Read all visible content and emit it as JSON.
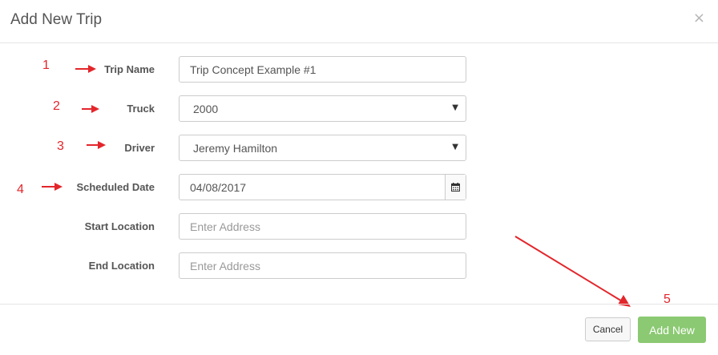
{
  "modal": {
    "title": "Add New Trip",
    "close_symbol": "×"
  },
  "form": {
    "trip_name": {
      "label": "Trip Name",
      "value": "Trip Concept Example #1"
    },
    "truck": {
      "label": "Truck",
      "value": "2000"
    },
    "driver": {
      "label": "Driver",
      "value": "Jeremy Hamilton"
    },
    "scheduled_date": {
      "label": "Scheduled Date",
      "value": "04/08/2017",
      "icon": "calendar-icon"
    },
    "start_location": {
      "label": "Start Location",
      "placeholder": "Enter Address"
    },
    "end_location": {
      "label": "End Location",
      "placeholder": "Enter Address"
    }
  },
  "annotations": {
    "numbers": [
      "1",
      "2",
      "3",
      "4",
      "5"
    ],
    "color": "#e3262b"
  },
  "footer": {
    "cancel_label": "Cancel",
    "add_label": "Add New",
    "add_color": "#8bc972"
  }
}
